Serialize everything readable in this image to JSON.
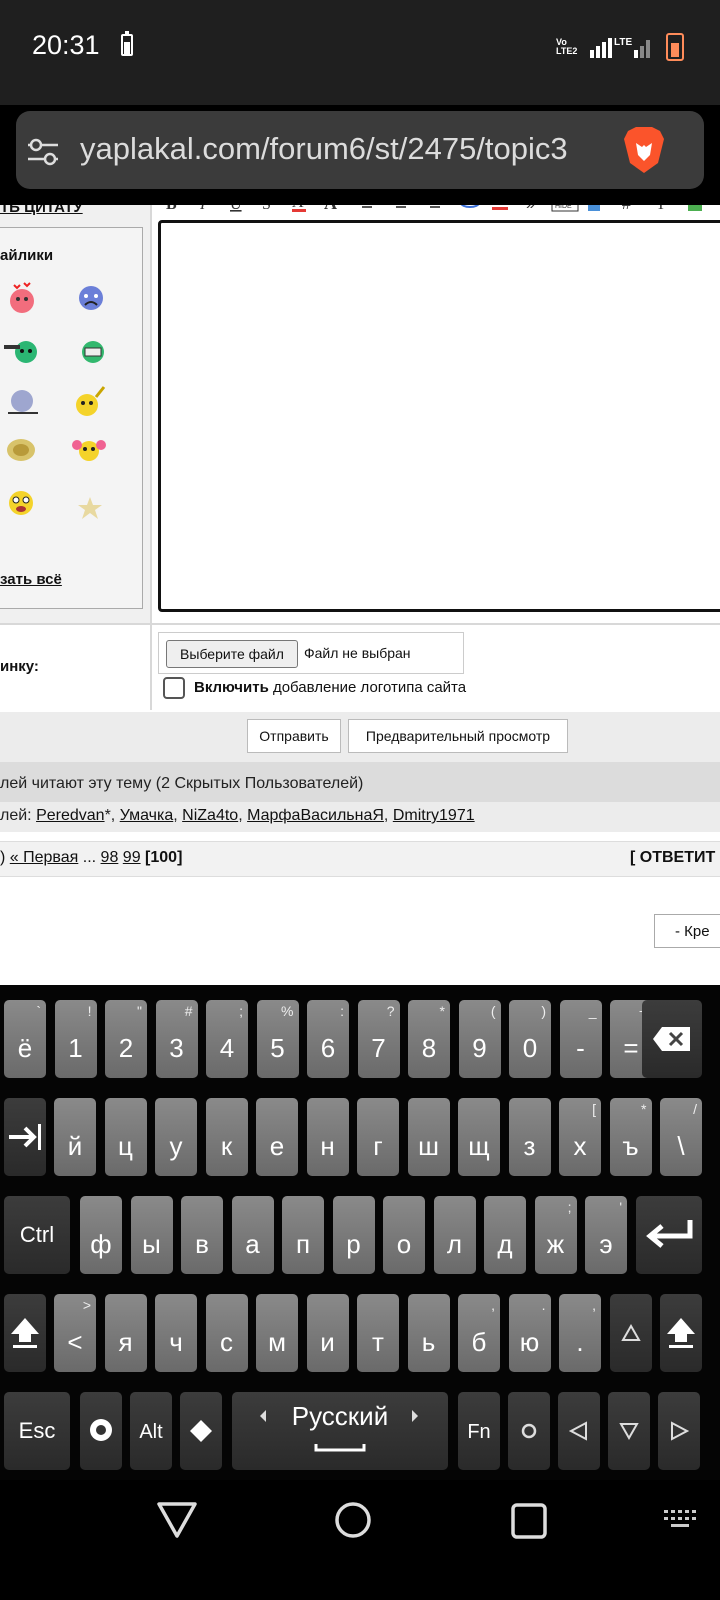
{
  "status_bar": {
    "time": "20:31",
    "volte": "VoLTE2",
    "lte": "LTE"
  },
  "browser": {
    "url": "yaplakal.com/forum6/st/2475/topic3"
  },
  "reply_form": {
    "quote_link": "ТЬ ЦИТАТУ",
    "smiles_title": "айлики",
    "show_all": "зать всё",
    "attach_label": "инку:",
    "file_button": "Выберите файл",
    "file_status": "Файл не выбран",
    "logo_bold": "Включить",
    "logo_rest": " добавление логотипа сайта",
    "send_button": "Отправить",
    "preview_button": "Предварительный просмотр"
  },
  "readers": {
    "summary": "лей читают эту тему (2 Скрытых Пользователей)",
    "users_prefix": "лей: ",
    "users": [
      "Peredvan",
      "Умачка",
      "NiZa4to",
      "МарфаВасильнаЯ",
      "Dmitry1971"
    ],
    "user_suffixes": [
      "*",
      "",
      "",
      "",
      ""
    ]
  },
  "pager": {
    "prefix": ") ",
    "first": "« Первая",
    "dots": " ... ",
    "page_98": "98",
    "page_99": "99",
    "current": "[100]",
    "reply": "[ ОТВЕТИТ"
  },
  "bottom_select": "- Кре",
  "keyboard": {
    "language": "Русский",
    "row1": [
      {
        "main": "ё",
        "sup": "`"
      },
      {
        "main": "1",
        "sup": "!"
      },
      {
        "main": "2",
        "sup": "\""
      },
      {
        "main": "3",
        "sup": "#"
      },
      {
        "main": "4",
        "sup": ";"
      },
      {
        "main": "5",
        "sup": "%"
      },
      {
        "main": "6",
        "sup": ":"
      },
      {
        "main": "7",
        "sup": "?"
      },
      {
        "main": "8",
        "sup": "*"
      },
      {
        "main": "9",
        "sup": "("
      },
      {
        "main": "0",
        "sup": ")"
      },
      {
        "main": "-",
        "sup": "_"
      },
      {
        "main": "=",
        "sup": "+"
      }
    ],
    "row2": [
      {
        "main": "й",
        "sup": ""
      },
      {
        "main": "ц",
        "sup": ""
      },
      {
        "main": "у",
        "sup": ""
      },
      {
        "main": "к",
        "sup": ""
      },
      {
        "main": "е",
        "sup": ""
      },
      {
        "main": "н",
        "sup": ""
      },
      {
        "main": "г",
        "sup": ""
      },
      {
        "main": "ш",
        "sup": ""
      },
      {
        "main": "щ",
        "sup": ""
      },
      {
        "main": "з",
        "sup": ""
      },
      {
        "main": "х",
        "sup": "["
      },
      {
        "main": "ъ",
        "sup": "*"
      },
      {
        "main": "\\",
        "sup": "/"
      }
    ],
    "row3": [
      {
        "main": "ф",
        "sup": ""
      },
      {
        "main": "ы",
        "sup": ""
      },
      {
        "main": "в",
        "sup": ""
      },
      {
        "main": "а",
        "sup": ""
      },
      {
        "main": "п",
        "sup": ""
      },
      {
        "main": "р",
        "sup": ""
      },
      {
        "main": "о",
        "sup": ""
      },
      {
        "main": "л",
        "sup": ""
      },
      {
        "main": "д",
        "sup": ""
      },
      {
        "main": "ж",
        "sup": ";"
      },
      {
        "main": "э",
        "sup": "'"
      }
    ],
    "row4": [
      {
        "main": "<",
        "sup": ">"
      },
      {
        "main": "я",
        "sup": ""
      },
      {
        "main": "ч",
        "sup": ""
      },
      {
        "main": "с",
        "sup": ""
      },
      {
        "main": "м",
        "sup": ""
      },
      {
        "main": "и",
        "sup": ""
      },
      {
        "main": "т",
        "sup": ""
      },
      {
        "main": "ь",
        "sup": ""
      },
      {
        "main": "б",
        "sup": ","
      },
      {
        "main": "ю",
        "sup": "."
      },
      {
        "main": ".",
        "sup": ","
      }
    ],
    "ctrl": "Ctrl",
    "esc": "Esc",
    "alt": "Alt",
    "fn": "Fn"
  }
}
